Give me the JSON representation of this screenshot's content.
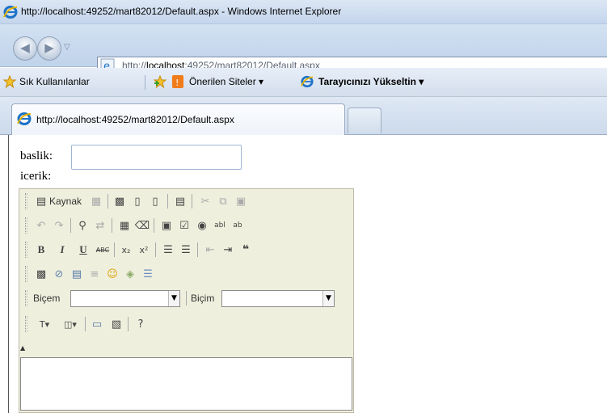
{
  "window": {
    "title": "http://localhost:49252/mart82012/Default.aspx - Windows Internet Explorer"
  },
  "nav": {
    "back_icon": "back-arrow-icon",
    "forward_icon": "forward-arrow-icon"
  },
  "address": {
    "prefix": "http://",
    "host": "localhost",
    "rest": ":49252/mart82012/Default.aspx"
  },
  "favorites": {
    "label": "Sık Kullanılanlar",
    "suggested": "Önerilen Siteler ▾",
    "upgrade": "Tarayıcınızı Yükseltin ▾"
  },
  "tabs": [
    {
      "label": "http://localhost:49252/mart82012/Default.aspx"
    }
  ],
  "form": {
    "baslik_label": "baslik:",
    "icerik_label": "icerik:",
    "baslik_value": ""
  },
  "editor": {
    "source_label": "Kaynak",
    "style_label": "Biçem",
    "format_label": "Biçim",
    "style_value": "",
    "format_value": "",
    "bold": "B",
    "italic": "I",
    "underline": "U",
    "strike": "ABC",
    "sub": "x₂",
    "sup": "x²",
    "quote": "❝"
  }
}
